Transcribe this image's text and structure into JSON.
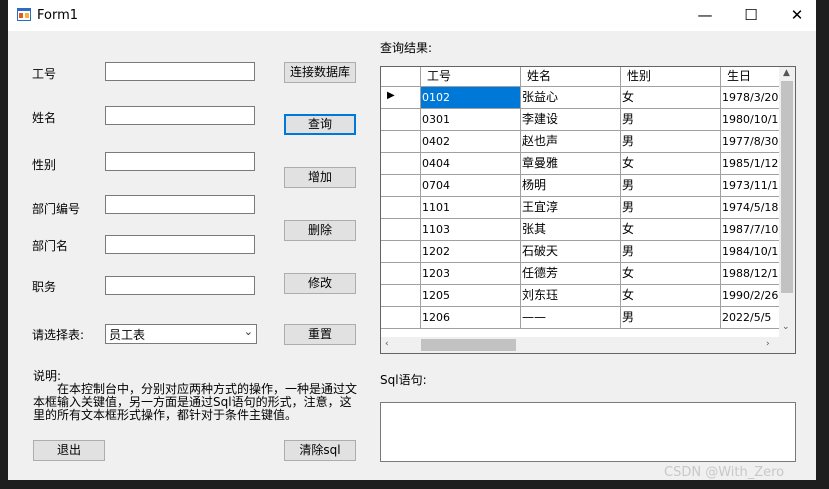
{
  "window": {
    "title": "Form1",
    "min_label": "—",
    "max_label": "☐",
    "close_label": "✕"
  },
  "form": {
    "fields": [
      {
        "label": "工号",
        "value": ""
      },
      {
        "label": "姓名",
        "value": ""
      },
      {
        "label": "性别",
        "value": ""
      },
      {
        "label": "部门编号",
        "value": ""
      },
      {
        "label": "部门名",
        "value": ""
      },
      {
        "label": "职务",
        "value": ""
      }
    ],
    "table_select": {
      "label": "请选择表:",
      "value": "员工表"
    }
  },
  "buttons": {
    "connect": "连接数据库",
    "query": "查询",
    "add": "增加",
    "delete": "删除",
    "modify": "修改",
    "reset": "重置",
    "exit": "退出",
    "clear_sql": "清除sql"
  },
  "note": {
    "title": "说明:",
    "body": "在本控制台中，分别对应两种方式的操作，一种是通过文本框输入关键值，另一方面是通过Sql语句的形式，注意，这里的所有文本框形式操作，都针对于条件主键值。"
  },
  "results": {
    "label": "查询结果:",
    "columns": [
      "工号",
      "姓名",
      "性别",
      "生日"
    ],
    "rows": [
      [
        "0102",
        "张益心",
        "女",
        "1978/3/20"
      ],
      [
        "0301",
        "李建设",
        "男",
        "1980/10/1"
      ],
      [
        "0402",
        "赵也声",
        "男",
        "1977/8/30"
      ],
      [
        "0404",
        "章曼雅",
        "女",
        "1985/1/12"
      ],
      [
        "0704",
        "杨明",
        "男",
        "1973/11/1"
      ],
      [
        "1101",
        "王宜淳",
        "男",
        "1974/5/18"
      ],
      [
        "1103",
        "张其",
        "女",
        "1987/7/10"
      ],
      [
        "1202",
        "石破天",
        "男",
        "1984/10/1"
      ],
      [
        "1203",
        "任德芳",
        "女",
        "1988/12/1"
      ],
      [
        "1205",
        "刘东珏",
        "女",
        "1990/2/26"
      ],
      [
        "1206",
        "——",
        "男",
        "2022/5/5"
      ]
    ]
  },
  "sql": {
    "label": "Sql语句:",
    "value": ""
  },
  "watermark": "CSDN @With_Zero"
}
